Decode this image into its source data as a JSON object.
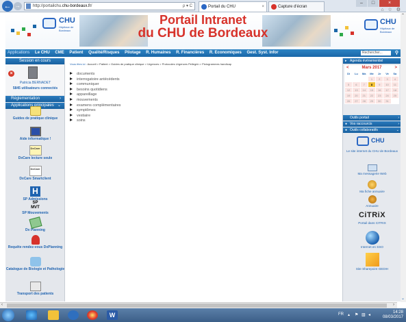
{
  "browser": {
    "url_prefix": "http://portailchu.",
    "url_host": "chu-bordeaux.fr",
    "url_suffix": "/",
    "addr_tools": "ρ ▾ C",
    "tabs": [
      {
        "label": "Portail du CHU",
        "favicon_color": "#2a67c4"
      },
      {
        "label": "Capture d'écran",
        "favicon_color": "#d7322a"
      }
    ],
    "close_tab": "×",
    "min": "–",
    "max": "□",
    "close": "×",
    "right_icons": "⌂ ☆ ⚙"
  },
  "banner": {
    "title_line1": "Portail Intranet",
    "title_line2": "du CHU de Bordeaux",
    "logo_left": "CHU",
    "logo_left_sub1": "Hôpitaux de",
    "logo_left_sub2": "Bordeaux",
    "logo_right": "CHU",
    "logo_right_sub1": "Hôpitaux de",
    "logo_right_sub2": "Bordeaux"
  },
  "menu": {
    "items": [
      "Applications",
      "Le CHU",
      "CME",
      "Patient",
      "Qualité/Risques",
      "Pilotage",
      "R. Humaines",
      "R. Financières",
      "R. Economiques",
      "Gest. Syst. Infor"
    ],
    "search_placeholder": "Rechercher...",
    "search_icon": "search-icon"
  },
  "left": {
    "session_header": "Session en cours",
    "user_name": "Patricia BERNADET",
    "users_connected": "5845 utilisateurs connectés",
    "btn_reglementation": "Réglementation",
    "btn_applications": "Applications principales",
    "apps": [
      {
        "label": "Guides de pratique clinique",
        "icon": "guide-icon"
      },
      {
        "label": "Aide informatique !",
        "icon": "help-computer-icon"
      },
      {
        "label": "DxCare lecture seule",
        "icon": "dxcare-icon"
      },
      {
        "label": "DxCare Smartclient",
        "icon": "dxcare-icon"
      },
      {
        "label": "SP Admissions",
        "icon": "hospital-h-icon"
      },
      {
        "label": "SP Mouvements",
        "icon": "sp-mvt-icon"
      },
      {
        "label": "Dx Planning",
        "icon": "planning-icon"
      },
      {
        "label": "Requête rendez-vous DxPlanning",
        "icon": "appointment-icon"
      },
      {
        "label": "Catalogue de Biologie et Pathologie",
        "icon": "biology-icon"
      },
      {
        "label": "Transport des patients",
        "icon": "transport-icon"
      }
    ],
    "sp_line1": "SP",
    "sp_line2": "MVT",
    "dxcare_text": "DxCare"
  },
  "content": {
    "crumb_label": "Vous êtes ici :",
    "crumb_path": "Accueil > Patient > Guides de pratique clinique > Urgences > Protocoles Urgences Pellegrin > Pictogrammes handicap",
    "items": [
      "documents",
      "interrogatoire antécédents",
      "communiquer",
      "besoins quotidiens",
      "appareillage",
      "mouvements",
      "examens complémentaires",
      "symptômes",
      "vestiaire",
      "soins"
    ]
  },
  "right": {
    "agenda_header": "Agenda événementiel",
    "calendar": {
      "month": "Mars 2017",
      "prev": "<",
      "next": ">",
      "days": [
        "Di",
        "Lu",
        "Ma",
        "Me",
        "Je",
        "Ve",
        "Sa"
      ],
      "weeks": [
        [
          "",
          "",
          "",
          "1",
          "2",
          "3",
          "4"
        ],
        [
          "5",
          "6",
          "7",
          "8",
          "9",
          "10",
          "11"
        ],
        [
          "12",
          "13",
          "14",
          "15",
          "16",
          "17",
          "18"
        ],
        [
          "19",
          "20",
          "21",
          "22",
          "23",
          "24",
          "25"
        ],
        [
          "26",
          "27",
          "28",
          "29",
          "30",
          "31",
          ""
        ]
      ],
      "today": "8"
    },
    "outils_portail": "Outils portail",
    "vos_raccourcis": "Vos raccourcis",
    "outils_collab": "Outils collaboratifs",
    "apps": [
      {
        "label": "Le site internet du CHU de Bordeaux",
        "icon": "chu-logo-icon"
      },
      {
        "label": "Ma messagerie Web",
        "icon": "mail-icon"
      },
      {
        "label": "Ma fiche annuaire",
        "icon": "profile-card-icon"
      },
      {
        "label": "Annuaire",
        "icon": "phone-icon"
      },
      {
        "label": "Portail dans CITRIX",
        "icon": "citrix-icon"
      },
      {
        "label": "Internet en SSO",
        "icon": "internet-globe-icon"
      },
      {
        "label": "Site Sharepoint GEDIH",
        "icon": "sharepoint-icon"
      }
    ],
    "citrix_text": "CiTRiX",
    "chu_text": "CHU"
  },
  "taskbar": {
    "lang": "FR",
    "time": "14:28",
    "date": "08/03/2017"
  }
}
